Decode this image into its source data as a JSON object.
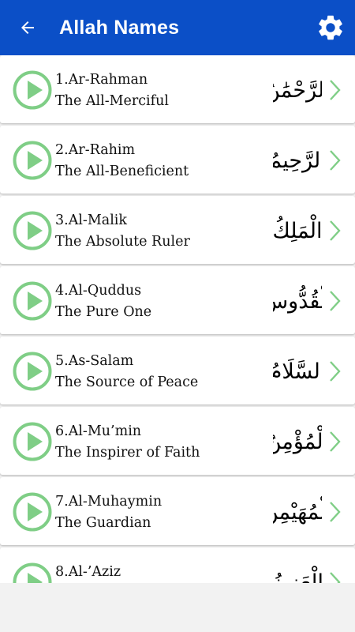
{
  "header": {
    "title": "Allah Names",
    "back_icon": "arrow-left-icon",
    "settings_icon": "gear-icon",
    "background_color": "#0b4fc7"
  },
  "accent_color": "#7fce86",
  "names": [
    {
      "title": "1.Ar-Rahman",
      "meaning": "The All-Merciful",
      "arabic": "الرَّحْمَٰنُ"
    },
    {
      "title": "2.Ar-Rahim",
      "meaning": "The All-Beneficient",
      "arabic": "الرَّحِيمُ"
    },
    {
      "title": "3.Al-Malik",
      "meaning": "The Absolute Ruler",
      "arabic": "الْمَلِكُ"
    },
    {
      "title": "4.Al-Quddus",
      "meaning": "The Pure One",
      "arabic": "الْقُدُّوسُ"
    },
    {
      "title": "5.As-Salam",
      "meaning": "The Source of Peace",
      "arabic": "السَّلَامُ"
    },
    {
      "title": "6.Al-Mu’min",
      "meaning": "The Inspirer of Faith",
      "arabic": "الْمُؤْمِنُ"
    },
    {
      "title": "7.Al-Muhaymin",
      "meaning": "The Guardian",
      "arabic": "الْمُهَيْمِنُ"
    },
    {
      "title": "8.Al-’Aziz",
      "meaning": "",
      "arabic": "الْعَزِيزُ"
    }
  ]
}
